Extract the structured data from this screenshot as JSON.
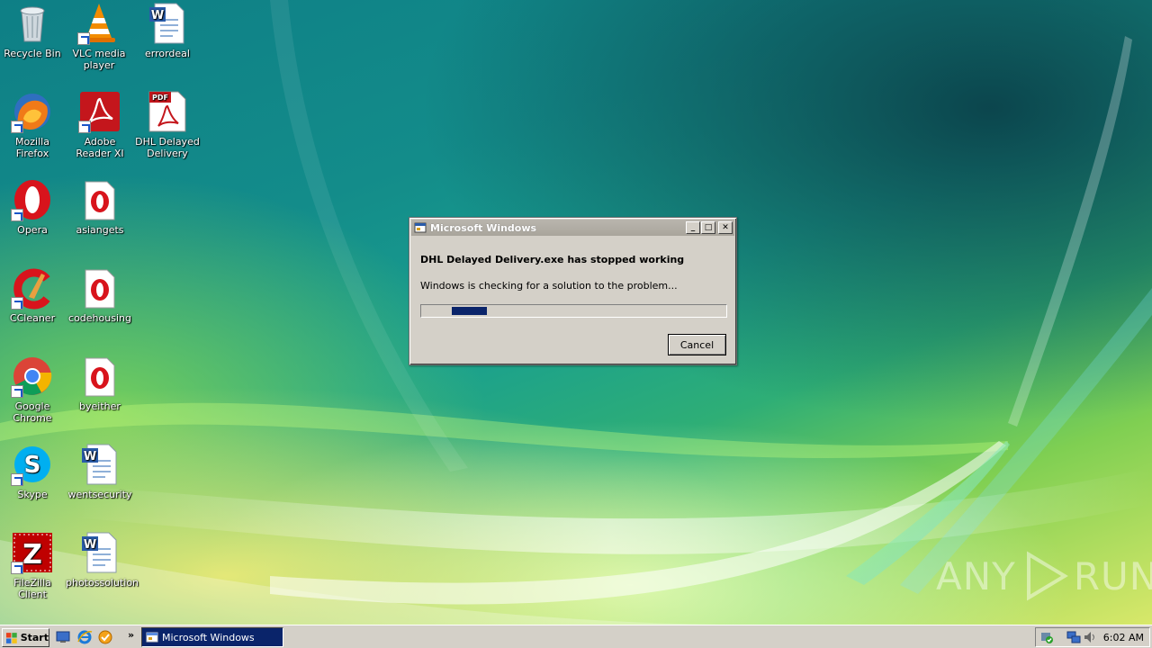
{
  "desktop": {
    "icons": [
      {
        "label": "Recycle Bin",
        "icon": "recycle-bin-icon"
      },
      {
        "label": "VLC media player",
        "icon": "vlc-icon"
      },
      {
        "label": "errordeal",
        "icon": "word-document-icon"
      },
      {
        "label": "Mozilla Firefox",
        "icon": "firefox-icon"
      },
      {
        "label": "Adobe Reader XI",
        "icon": "adobe-reader-icon"
      },
      {
        "label": "DHL Delayed Delivery",
        "icon": "pdf-document-icon"
      },
      {
        "label": "Opera",
        "icon": "opera-icon"
      },
      {
        "label": "asiangets",
        "icon": "opera-document-icon"
      },
      {
        "label": "CCleaner",
        "icon": "ccleaner-icon"
      },
      {
        "label": "codehousing",
        "icon": "opera-document-icon"
      },
      {
        "label": "Google Chrome",
        "icon": "chrome-icon"
      },
      {
        "label": "byeither",
        "icon": "opera-document-icon"
      },
      {
        "label": "Skype",
        "icon": "skype-icon"
      },
      {
        "label": "wentsecurity",
        "icon": "word-document-icon"
      },
      {
        "label": "FileZilla Client",
        "icon": "filezilla-icon"
      },
      {
        "label": "photossolution",
        "icon": "word-document-icon"
      }
    ]
  },
  "dialog": {
    "title": "Microsoft Windows",
    "heading": "DHL Delayed Delivery.exe has stopped working",
    "message": "Windows is checking for a solution to the problem...",
    "progress_state": "indeterminate",
    "cancel_label": "Cancel",
    "minimize_glyph": "_",
    "maximize_glyph": "□",
    "close_glyph": "✕"
  },
  "taskbar": {
    "start_label": "Start",
    "quick_launch": [
      "show-desktop-icon",
      "internet-explorer-icon",
      "media-player-icon"
    ],
    "chevron": "»",
    "active_task": "Microsoft Windows",
    "clock": "6:02 AM",
    "tray_icons": [
      "security-shield-icon",
      "network-icon",
      "volume-icon"
    ]
  },
  "watermark": {
    "left": "ANY",
    "right": "RUN"
  },
  "colors": {
    "selection_blue": "#0a246a",
    "dialog_face": "#d4d0c8",
    "titlebar_inactive": "#a9a59c"
  }
}
